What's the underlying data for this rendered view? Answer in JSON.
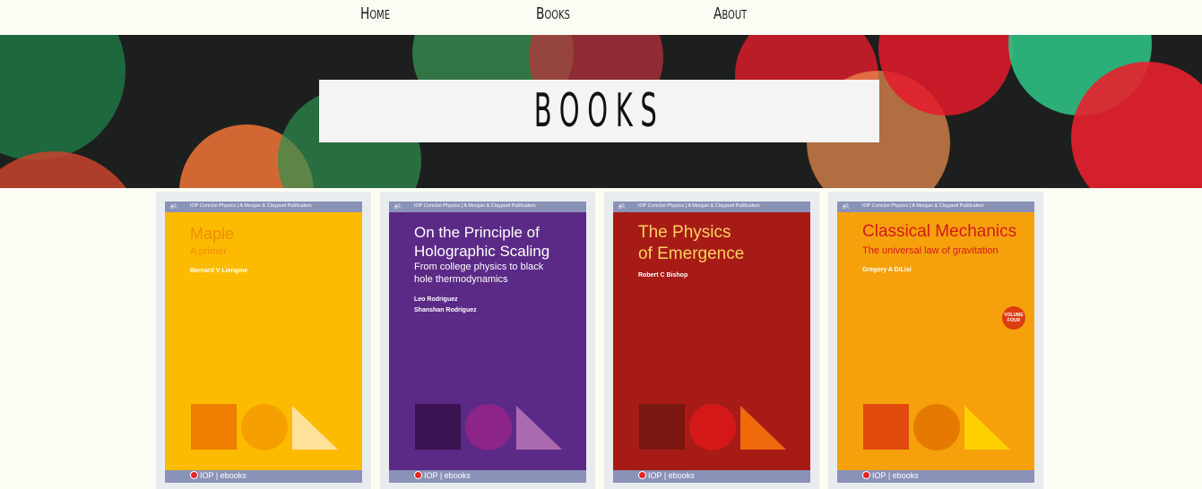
{
  "nav": {
    "home": "Home",
    "books": "Books",
    "about": "About"
  },
  "hero": {
    "title": "BOOKS"
  },
  "books": [
    {
      "logo": "ꜰ⁄ₜ",
      "series": "IOP Concise Physics  |  A Morgan & Claypool Publication",
      "title": "Maple",
      "subtitle": "A primer",
      "authors": "Bernard V Liengme",
      "footer": "IOP | ebooks",
      "colors": {
        "bg": "#fdbb00",
        "title": "#f28a00",
        "subtitle": "#f28a00",
        "authors": "#ffffff",
        "square": "#f07f00",
        "circle": "#f5a000",
        "triangle": "#ffe19a"
      }
    },
    {
      "logo": "ꜰ⁄ₜ",
      "series": "IOP Concise Physics  |  A Morgan & Claypool Publication",
      "title": "On the Principle of\nHolographic Scaling",
      "subtitle": "From college physics to black\nhole thermodynamics",
      "authors": "Leo Rodriguez\nShanshan Rodriguez",
      "footer": "IOP | ebooks",
      "colors": {
        "bg": "#5b2a86",
        "title": "#ffffff",
        "subtitle": "#ffffff",
        "authors": "#ffffff",
        "square": "#3c1352",
        "circle": "#8c2489",
        "triangle": "#ab6ab0"
      }
    },
    {
      "logo": "ꜰ⁄ₜ",
      "series": "IOP Concise Physics  |  A Morgan & Claypool Publication",
      "title": "The Physics\nof Emergence",
      "subtitle": "",
      "authors": "Robert C Bishop",
      "footer": "IOP | ebooks",
      "colors": {
        "bg": "#a71b16",
        "title": "#fed15f",
        "subtitle": "#fed15f",
        "authors": "#ffffff",
        "square": "#7a1711",
        "circle": "#d41818",
        "triangle": "#ef6a0c"
      }
    },
    {
      "logo": "ꜰ⁄ₜ",
      "series": "IOP Concise Physics  |  A Morgan & Claypool Publication",
      "title": "Classical Mechanics",
      "subtitle": "The universal law of gravitation",
      "authors": "Gregory A DiLisi",
      "badge": "VOLUME\nFOUR",
      "footer": "IOP | ebooks",
      "colors": {
        "bg": "#f6a10c",
        "title": "#d41a1a",
        "subtitle": "#d41a1a",
        "authors": "#ffffff",
        "square": "#e14c0e",
        "circle": "#e67a00",
        "triangle": "#ffd000"
      }
    }
  ]
}
